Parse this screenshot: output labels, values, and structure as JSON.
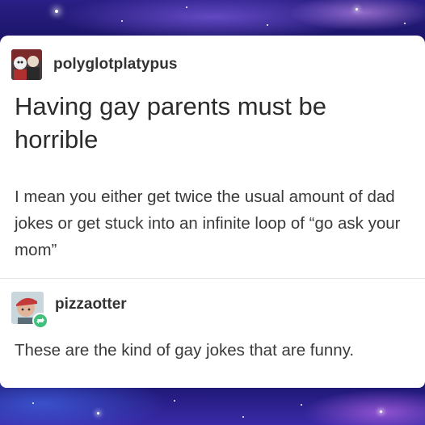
{
  "post": {
    "author": "polyglotplatypus",
    "title": "Having gay parents must be horrible",
    "body": "I mean you either get twice the usual amount of dad jokes or get stuck into an infinite loop of “go ask your mom”",
    "avatar_icon": "user-avatar-icon"
  },
  "reblog": {
    "author": "pizzaotter",
    "body": "These are the kind of gay jokes that are funny.",
    "avatar_icon": "user-avatar-icon",
    "badge_icon": "reblog-icon",
    "badge_color": "#3fbf7a"
  },
  "colors": {
    "background": "#1a1466",
    "card": "#ffffff",
    "text": "#333333"
  }
}
